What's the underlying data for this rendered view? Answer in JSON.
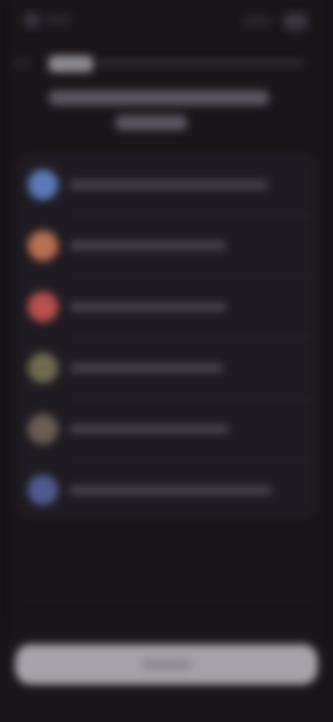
{
  "screen": {
    "background": "#1a161b",
    "note_visible_text": ""
  },
  "header": {
    "chip_label": "",
    "subtitle": "",
    "title_line_1": "",
    "title_line_2": ""
  },
  "list": {
    "items": [
      {
        "label": "",
        "icon": "circle-icon",
        "color": "#5b79b8"
      },
      {
        "label": "",
        "icon": "circle-icon",
        "color": "#b6704f"
      },
      {
        "label": "",
        "icon": "circle-icon",
        "color": "#b8504c"
      },
      {
        "label": "",
        "icon": "circle-icon",
        "color": "#6f6a4e"
      },
      {
        "label": "",
        "icon": "circle-icon",
        "color": "#6a5c52"
      },
      {
        "label": "",
        "icon": "circle-icon",
        "color": "#4f5a8d"
      }
    ]
  },
  "footer": {
    "primary_button_label": ""
  }
}
